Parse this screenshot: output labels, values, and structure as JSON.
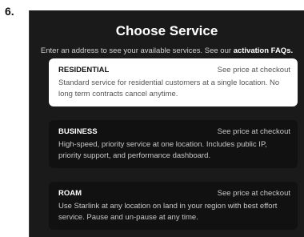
{
  "step_number": "6.",
  "header": {
    "title": "Choose Service",
    "subtitle_text": "Enter an address to see your available services. See our",
    "faq_link": "activation FAQs."
  },
  "services": [
    {
      "name": "RESIDENTIAL",
      "price": "See price at checkout",
      "description": "Standard service for residential customers at a single location. No long term contracts cancel anytime.",
      "selected": true
    },
    {
      "name": "BUSINESS",
      "price": "See price at checkout",
      "description": "High-speed, priority service at one location. Includes public IP, priority support, and performance dashboard.",
      "selected": false
    },
    {
      "name": "ROAM",
      "price": "See price at checkout",
      "description": "Use Starlink at any location on land in your region with best effort service. Pause and un-pause at any time.",
      "selected": false
    }
  ],
  "colors": {
    "panel_background": "#1a1a1a",
    "selected_card": "#ffffff",
    "unselected_card": "#111111"
  }
}
